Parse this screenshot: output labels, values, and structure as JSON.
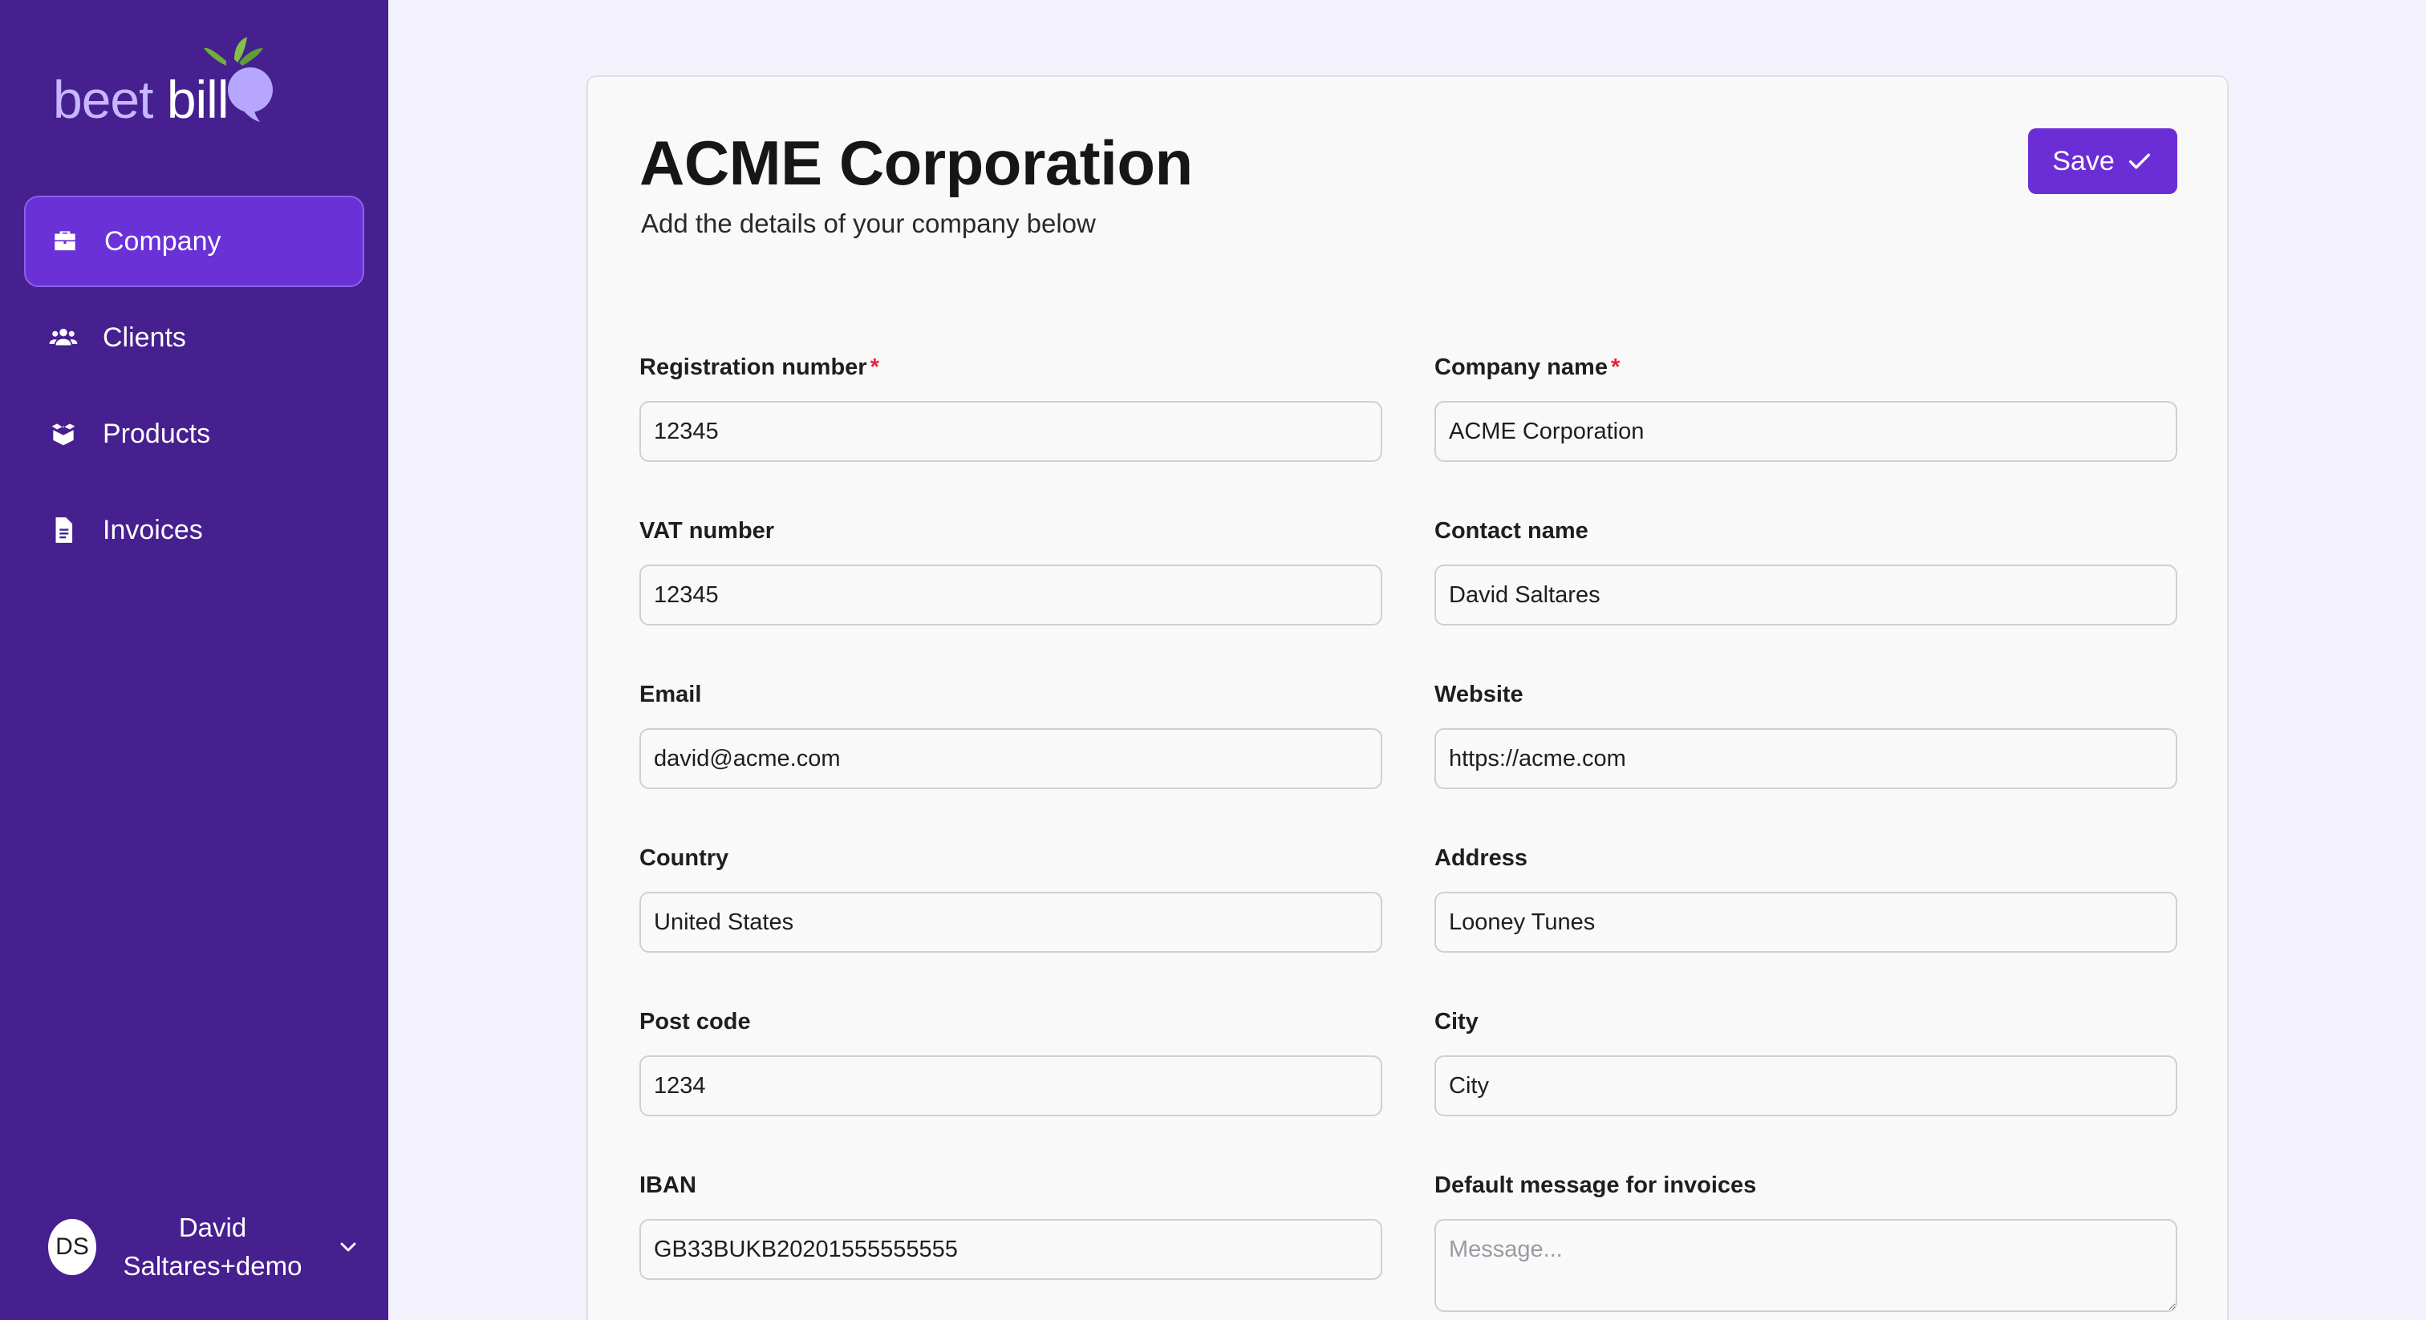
{
  "brand": {
    "part1": "beet",
    "part2": "bill"
  },
  "sidebar": {
    "items": [
      {
        "label": "Company",
        "icon": "briefcase-icon",
        "active": true
      },
      {
        "label": "Clients",
        "icon": "users-icon",
        "active": false
      },
      {
        "label": "Products",
        "icon": "box-icon",
        "active": false
      },
      {
        "label": "Invoices",
        "icon": "document-icon",
        "active": false
      }
    ],
    "user": {
      "initials": "DS",
      "name": "David Saltares+demo"
    }
  },
  "page": {
    "title": "ACME Corporation",
    "subtitle": "Add the details of your company below",
    "save_label": "Save",
    "required_mark": "*"
  },
  "form": {
    "registration_number": {
      "label": "Registration number",
      "value": "12345"
    },
    "company_name": {
      "label": "Company name",
      "value": "ACME Corporation"
    },
    "vat_number": {
      "label": "VAT number",
      "value": "12345"
    },
    "contact_name": {
      "label": "Contact name",
      "value": "David Saltares"
    },
    "email": {
      "label": "Email",
      "value": "david@acme.com"
    },
    "website": {
      "label": "Website",
      "value": "https://acme.com"
    },
    "country": {
      "label": "Country",
      "value": "United States"
    },
    "address": {
      "label": "Address",
      "value": "Looney Tunes"
    },
    "post_code": {
      "label": "Post code",
      "value": "1234"
    },
    "city": {
      "label": "City",
      "value": "City"
    },
    "iban": {
      "label": "IBAN",
      "value": "GB33BUKB20201555555555"
    },
    "default_message": {
      "label": "Default message for invoices",
      "placeholder": "Message..."
    }
  },
  "colors": {
    "sidebar_bg": "#46208f",
    "accent": "#6b2ed6",
    "required": "#e0263c"
  }
}
